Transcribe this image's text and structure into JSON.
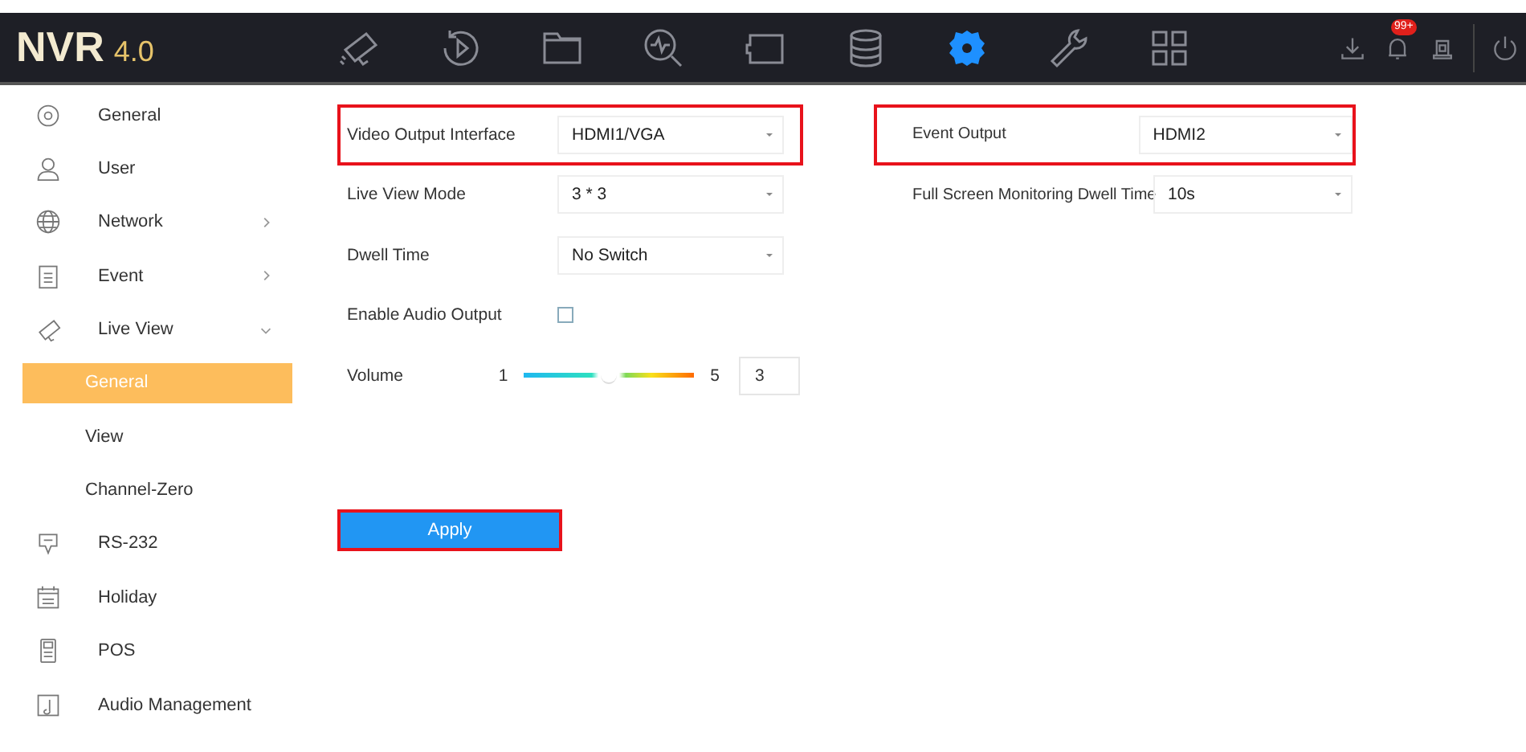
{
  "header": {
    "logo": "NVR",
    "version": "4.0",
    "nav": [
      {
        "kind": "camera",
        "selected": false
      },
      {
        "kind": "playback",
        "selected": false
      },
      {
        "kind": "folder",
        "selected": false
      },
      {
        "kind": "search",
        "selected": false
      },
      {
        "kind": "screen",
        "selected": false
      },
      {
        "kind": "storage",
        "selected": false
      },
      {
        "kind": "gear",
        "selected": true
      },
      {
        "kind": "wrench",
        "selected": false
      },
      {
        "kind": "grid",
        "selected": false
      }
    ],
    "tools": [
      {
        "kind": "download"
      },
      {
        "kind": "bell",
        "badge": "99+"
      },
      {
        "kind": "alarm"
      },
      {
        "kind": "power"
      }
    ]
  },
  "sidebar": {
    "items": [
      {
        "label": "General",
        "kind": "gear",
        "selected": false
      },
      {
        "label": "User",
        "kind": "user",
        "selected": false
      },
      {
        "label": "Network",
        "kind": "globe",
        "selected": false,
        "expanded": false
      },
      {
        "label": "Event",
        "kind": "clipboard",
        "selected": false,
        "expanded": false
      },
      {
        "label": "Live View",
        "kind": "camera",
        "selected": false,
        "expanded": true,
        "children": [
          {
            "label": "General",
            "selected": true
          },
          {
            "label": "View",
            "selected": false
          },
          {
            "label": "Channel-Zero",
            "selected": false
          }
        ]
      },
      {
        "label": "RS-232",
        "kind": "bubble",
        "selected": false
      },
      {
        "label": "Holiday",
        "kind": "calendar",
        "selected": false
      },
      {
        "label": "POS",
        "kind": "pos",
        "selected": false
      },
      {
        "label": "Audio Management",
        "kind": "music",
        "selected": false
      }
    ]
  },
  "form_left": [
    {
      "kind": "select",
      "label": "Video Output Interface",
      "value": "HDMI1/VGA",
      "highlighted": true
    },
    {
      "kind": "select",
      "label": "Live View Mode",
      "value": "3 * 3",
      "highlighted": false
    },
    {
      "kind": "select",
      "label": "Dwell Time",
      "value": "No Switch",
      "highlighted": false
    },
    {
      "kind": "checkbox",
      "label": "Enable Audio Output",
      "checked": false
    },
    {
      "kind": "slider",
      "label": "Volume",
      "min": "1",
      "max": "5",
      "level": 0.5,
      "value": "3"
    }
  ],
  "form_right": [
    {
      "kind": "select",
      "label": "Event Output",
      "value": "HDMI2",
      "highlighted": true
    },
    {
      "kind": "select",
      "label": "Full Screen Monitoring Dwell Time",
      "value": "10s",
      "highlighted": false
    }
  ],
  "apply_button": {
    "label": "Apply",
    "highlighted": true
  }
}
